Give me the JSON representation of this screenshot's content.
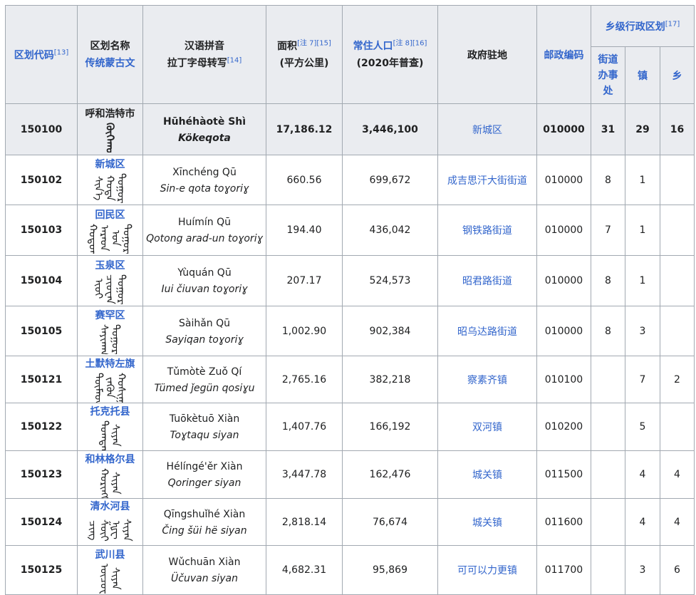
{
  "headers": {
    "code": {
      "label": "区划代码",
      "ref": "[13]"
    },
    "name": {
      "line1": "区划名称",
      "line2": "传统蒙古文"
    },
    "pinyin": {
      "line1": "汉语拼音",
      "line2": "拉丁字母转写",
      "ref": "[14]"
    },
    "area": {
      "line1": "面积",
      "note": "[注 7]",
      "ref": "[15]",
      "line2": "(平方公里)"
    },
    "pop": {
      "line1": "常住人口",
      "note": "[注 8]",
      "ref": "[16]",
      "line2": "(2020年普查)"
    },
    "seat": {
      "label": "政府驻地"
    },
    "postal": {
      "label": "邮政编码"
    },
    "township": {
      "label": "乡级行政区划",
      "ref": "[17]"
    },
    "sub_jd": {
      "l1": "街道",
      "l2": "办事",
      "l3": "处"
    },
    "sub_zhen": "镇",
    "sub_xiang": "乡"
  },
  "rows": [
    {
      "code": "150100",
      "name": "呼和浩特市",
      "mongol": "ᠬᠥᠬᠡᠬᠣᠲᠠ",
      "pinyin": "Hūhéhàotè Shì",
      "latin": "Kökeqota",
      "area": "17,186.12",
      "pop": "3,446,100",
      "seat": "新城区",
      "postal": "010000",
      "jd": "31",
      "zhen": "29",
      "xiang": "16"
    },
    {
      "code": "150102",
      "name": "新城区",
      "mongol": "ᠰᠢᠨ᠎ᠡ ᠬᠣᠲᠠ ᠲᠣᠭᠣᠷᠢᠭ",
      "pinyin": "Xīnchéng Qū",
      "latin": "Sin-e qota toɣoriɣ",
      "area": "660.56",
      "pop": "699,672",
      "seat": "成吉思汗大街街道",
      "postal": "010000",
      "jd": "8",
      "zhen": "1",
      "xiang": ""
    },
    {
      "code": "150103",
      "name": "回民区",
      "mongol": "ᠬᠣᠲᠣᠩ ᠠᠷᠠᠳ ᠤᠨ ᠲᠣᠭᠣᠷᠢᠭ",
      "pinyin": "Huímín Qū",
      "latin": "Qotong arad-un toɣoriɣ",
      "area": "194.40",
      "pop": "436,042",
      "seat": "钢铁路街道",
      "postal": "010000",
      "jd": "7",
      "zhen": "1",
      "xiang": ""
    },
    {
      "code": "150104",
      "name": "玉泉区",
      "mongol": "ᠢᠦᠢ ᠴᠢᠤᠸᠠᠨ ᠲᠣᠭᠣᠷᠢᠭ",
      "pinyin": "Yùquán Qū",
      "latin": "Iui čiuvan toɣoriɣ",
      "area": "207.17",
      "pop": "524,573",
      "seat": "昭君路街道",
      "postal": "010000",
      "jd": "8",
      "zhen": "1",
      "xiang": ""
    },
    {
      "code": "150105",
      "name": "赛罕区",
      "mongol": "ᠰᠠᠶᠢᠬᠠᠨ ᠲᠣᠭᠣᠷᠢᠭ",
      "pinyin": "Sàihǎn Qū",
      "latin": "Sayiqan toɣoriɣ",
      "area": "1,002.90",
      "pop": "902,384",
      "seat": "昭乌达路街道",
      "postal": "010000",
      "jd": "8",
      "zhen": "3",
      "xiang": ""
    },
    {
      "code": "150121",
      "name": "土默特左旗",
      "mongol": "ᠲᠦᠮᠡᠳ ᠵᠡᠭᠦᠨ ᠬᠣᠰᠢᠭᠤ",
      "pinyin": "Tǔmòtè Zuǒ Qí",
      "latin": "Tümed ǰegün qosiɣu",
      "area": "2,765.16",
      "pop": "382,218",
      "seat": "察素齐镇",
      "postal": "010100",
      "jd": "",
      "zhen": "7",
      "xiang": "2"
    },
    {
      "code": "150122",
      "name": "托克托县",
      "mongol": "ᠲᠣᠭᠲᠠᠬᠤ ᠰᠢᠶᠠᠨ",
      "pinyin": "Tuōkètuō Xiàn",
      "latin": "Toɣtaqu siyan",
      "area": "1,407.76",
      "pop": "166,192",
      "seat": "双河镇",
      "postal": "010200",
      "jd": "",
      "zhen": "5",
      "xiang": ""
    },
    {
      "code": "150123",
      "name": "和林格尔县",
      "mongol": "ᠬᠣᠷᠢᠩᠭᠡᠷ ᠰᠢᠶᠠᠨ",
      "pinyin": "Hélíngé'ěr Xiàn",
      "latin": "Qoringer siyan",
      "area": "3,447.78",
      "pop": "162,476",
      "seat": "城关镇",
      "postal": "011500",
      "jd": "",
      "zhen": "4",
      "xiang": "4"
    },
    {
      "code": "150124",
      "name": "清水河县",
      "mongol": "ᠴᠢᠩ ᠱᠦᠢ ᠾᠧ ᠰᠢᠶᠠᠨ",
      "pinyin": "Qīngshuǐhé Xiàn",
      "latin": "Čing šüi hë siyan",
      "area": "2,818.14",
      "pop": "76,674",
      "seat": "城关镇",
      "postal": "011600",
      "jd": "",
      "zhen": "4",
      "xiang": "4"
    },
    {
      "code": "150125",
      "name": "武川县",
      "mongol": "ᠦᠴᠤᠸᠠᠨ ᠰᠢᠶᠠᠨ",
      "pinyin": "Wǔchuān Xiàn",
      "latin": "Üčuvan siyan",
      "area": "4,682.31",
      "pop": "95,869",
      "seat": "可可以力更镇",
      "postal": "011700",
      "jd": "",
      "zhen": "3",
      "xiang": "6"
    }
  ]
}
